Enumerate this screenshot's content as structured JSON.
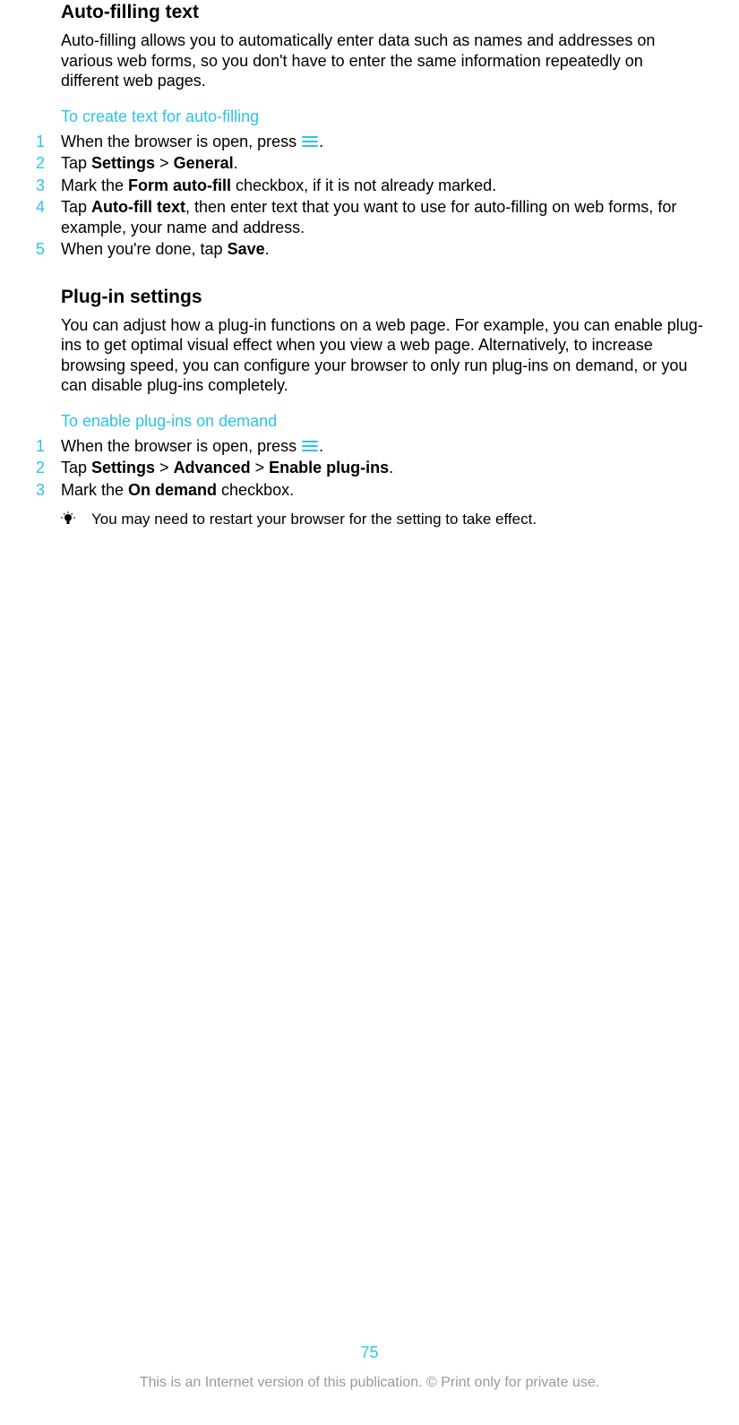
{
  "section1": {
    "heading": "Auto-filling text",
    "body": "Auto-filling allows you to automatically enter data such as names and addresses on various web forms, so you don't have to enter the same information repeatedly on different web pages.",
    "subheading": "To create text for auto-filling",
    "steps": [
      {
        "num": "1",
        "prefix": "When the browser is open, press ",
        "suffix": "."
      },
      {
        "num": "2",
        "parts": [
          "Tap ",
          "Settings",
          " > ",
          "General",
          "."
        ]
      },
      {
        "num": "3",
        "parts": [
          "Mark the ",
          "Form auto-fill",
          " checkbox, if it is not already marked."
        ]
      },
      {
        "num": "4",
        "parts": [
          "Tap ",
          "Auto-fill text",
          ", then enter text that you want to use for auto-filling on web forms, for example, your name and address."
        ]
      },
      {
        "num": "5",
        "parts": [
          "When you're done, tap ",
          "Save",
          "."
        ]
      }
    ]
  },
  "section2": {
    "heading": "Plug-in settings",
    "body": "You can adjust how a plug-in functions on a web page. For example, you can enable plug-ins to get optimal visual effect when you view a web page. Alternatively, to increase browsing speed, you can configure your browser to only run plug-ins on demand, or you can disable plug-ins completely.",
    "subheading": "To enable plug-ins on demand",
    "steps": [
      {
        "num": "1",
        "prefix": "When the browser is open, press ",
        "suffix": "."
      },
      {
        "num": "2",
        "parts": [
          "Tap ",
          "Settings",
          " > ",
          "Advanced",
          " > ",
          "Enable plug-ins",
          "."
        ]
      },
      {
        "num": "3",
        "parts": [
          "Mark the ",
          "On demand",
          " checkbox."
        ]
      }
    ],
    "tip": "You may need to restart your browser for the setting to take effect."
  },
  "pagenum": "75",
  "footer": "This is an Internet version of this publication. © Print only for private use."
}
